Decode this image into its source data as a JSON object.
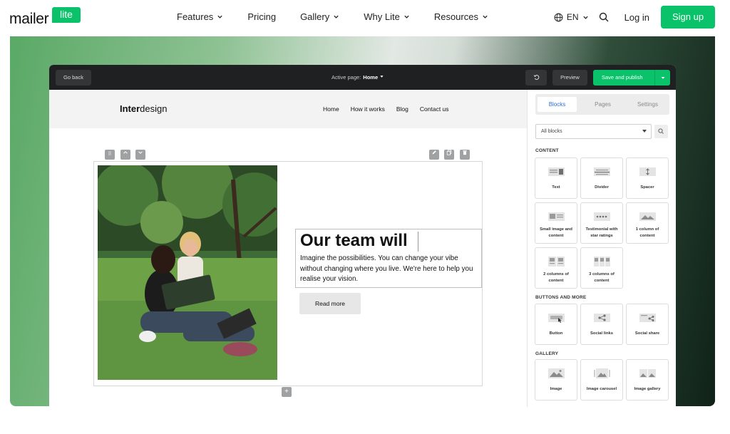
{
  "brand": {
    "logo_text": "mailer",
    "logo_badge": "lite"
  },
  "nav": {
    "items": [
      {
        "label": "Features",
        "dropdown": true
      },
      {
        "label": "Pricing",
        "dropdown": false
      },
      {
        "label": "Gallery",
        "dropdown": true
      },
      {
        "label": "Why Lite",
        "dropdown": true
      },
      {
        "label": "Resources",
        "dropdown": true
      }
    ],
    "language": "EN",
    "login": "Log in",
    "signup": "Sign up"
  },
  "editor": {
    "go_back": "Go back",
    "active_page_label": "Active page:",
    "active_page_value": "Home",
    "preview": "Preview",
    "publish": "Save and publish"
  },
  "site": {
    "logo_bold": "Inter",
    "logo_rest": "design",
    "nav": [
      "Home",
      "How it works",
      "Blog",
      "Contact us"
    ],
    "headline": "Our team will",
    "paragraph": "Imagine the possibilities. You can change your vibe without changing where you live. We're here to help you realise your vision.",
    "button": "Read more"
  },
  "panel": {
    "tabs": [
      "Blocks",
      "Pages",
      "Settings"
    ],
    "active_tab": "Blocks",
    "filter": "All blocks",
    "categories": [
      {
        "title": "CONTENT",
        "blocks": [
          "Text",
          "Divider",
          "Spacer",
          "Small image and content",
          "Testimonial with star ratings",
          "1 column of content",
          "2 columns of content",
          "3 columns of content"
        ]
      },
      {
        "title": "BUTTONS AND MORE",
        "blocks": [
          "Button",
          "Social links",
          "Social share"
        ]
      },
      {
        "title": "GALLERY",
        "blocks": [
          "Image",
          "Image carousel",
          "Image gallery"
        ]
      }
    ]
  },
  "colors": {
    "brand_green": "#09c269",
    "toolbar": "#1f2021",
    "tab_active": "#2c6fd6"
  }
}
